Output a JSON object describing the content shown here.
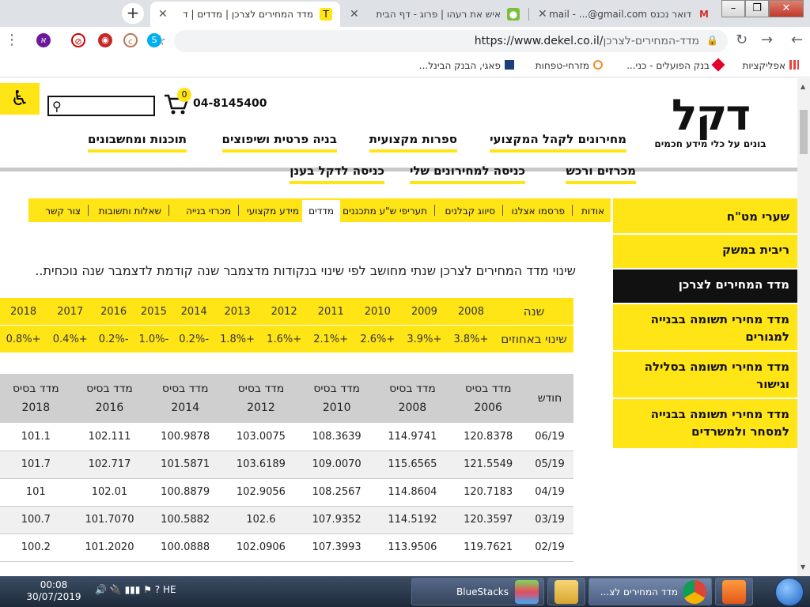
{
  "browser": {
    "tabs": [
      {
        "title": "מדד המחירים לצרכן | מדדים | ד",
        "favicon": "dekel-favicon",
        "active": true
      },
      {
        "title": "איש את רעהו | פרוג - דף הבית",
        "favicon": "prog-favicon",
        "active": false
      },
      {
        "title": "דואר נכנס Gmail - ...@gmail.com",
        "favicon": "gmail-favicon",
        "active": false
      }
    ],
    "new_tab": "+",
    "url_host": "https://www.dekel.co.il/",
    "url_path": "מדד-המחירים-לצרכן",
    "bookmarks": [
      {
        "label": "אפליקציות",
        "color": "#e8453c"
      },
      {
        "label": "בנק הפועלים - כני...",
        "color": "#e4002b"
      },
      {
        "label": "מזרחי-טפחות",
        "color": "#f28c28"
      },
      {
        "label": "פאגי, הבנק הבינל...",
        "color": "#1c3f7a"
      }
    ]
  },
  "header": {
    "logo": "דקל",
    "tagline": "בונים על כלי מידע חכמים",
    "phone": "04-8145400",
    "cart_count": "0",
    "search_placeholder": ""
  },
  "main_nav": [
    "מחירונים לקהל המקצועי",
    "ספרות מקצועית",
    "בניה פרטית ושיפוצים",
    "תוכנות ומחשבונים",
    "מכרזים ורכש",
    "כניסה למחירונים שלי",
    "כניסה לדקל בענן"
  ],
  "sub_nav": [
    "אודות",
    "פרסמו אצלנו",
    "סיווג קבלנים",
    "תעריפי ש\"ע מתכננים",
    "מדדים",
    "מידע מקצועי",
    "מכרזי בנייה",
    "שאלות ותשובות",
    "צור קשר"
  ],
  "sidebar": [
    "שערי מט\"ח",
    "ריבית במשק",
    "מדד המחירים לצרכן",
    "מדד מחירי תשומה בבנייה למגורים",
    "מדד מחירי תשומה בסלילה וגישור",
    "מדד מחירי תשומה בבנייה למסחר ולמשרדים"
  ],
  "description": "שינוי מדד המחירים לצרכן שנתי מחושב לפי שינוי בנקודות מדצמבר שנה קודמת לדצמבר שנה נוכחית..",
  "year_table": {
    "year_label": "שנה",
    "change_label": "שינוי באחוזים",
    "years": [
      "2008",
      "2009",
      "2010",
      "2011",
      "2012",
      "2013",
      "2014",
      "2015",
      "2016",
      "2017",
      "2018"
    ],
    "changes": [
      "+3.8%",
      "+3.9%",
      "+2.6%",
      "+2.1%",
      "+1.6%",
      "+1.8%",
      "-0.2%",
      "-1.0%",
      "-0.2%",
      "+0.4%",
      "+0.8%"
    ]
  },
  "base_table": {
    "month_header": "חודש",
    "base_label": "מדד בסיס",
    "base_years": [
      "2006",
      "2008",
      "2010",
      "2012",
      "2014",
      "2016",
      "2018"
    ],
    "rows": [
      {
        "month": "06/19",
        "values": [
          "120.8378",
          "114.9741",
          "108.3639",
          "103.0075",
          "100.9878",
          "102.111",
          "101.1"
        ]
      },
      {
        "month": "05/19",
        "values": [
          "121.5549",
          "115.6565",
          "109.0070",
          "103.6189",
          "101.5871",
          "102.717",
          "101.7"
        ]
      },
      {
        "month": "04/19",
        "values": [
          "120.7183",
          "114.8604",
          "108.2567",
          "102.9056",
          "100.8879",
          "102.01",
          "101"
        ]
      },
      {
        "month": "03/19",
        "values": [
          "120.3597",
          "114.5192",
          "107.9352",
          "102.6",
          "100.5882",
          "101.7070",
          "100.7"
        ]
      },
      {
        "month": "02/19",
        "values": [
          "119.7621",
          "113.9506",
          "107.3993",
          "102.0906",
          "100.0888",
          "101.2020",
          "100.2"
        ]
      }
    ]
  },
  "taskbar": {
    "time": "00:08",
    "date": "30/07/2019",
    "lang": "HE",
    "bluestacks": "BlueStacks",
    "chrome_window": "מדד המחירים לצ..."
  },
  "colors": {
    "brand_yellow": "#ffe516",
    "active_black": "#111111"
  }
}
